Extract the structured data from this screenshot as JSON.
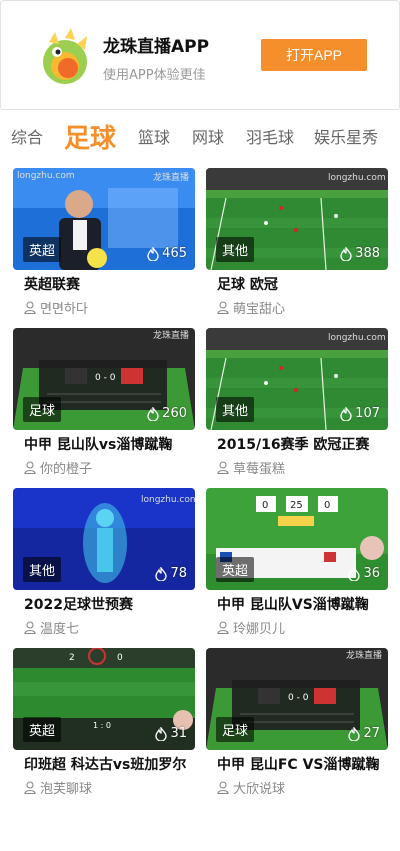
{
  "banner": {
    "title": "龙珠直播APP",
    "subtitle": "使用APP体验更佳",
    "open_button": "打开APP"
  },
  "tabs": [
    {
      "label": "综合",
      "active": false
    },
    {
      "label": "足球",
      "active": true
    },
    {
      "label": "篮球",
      "active": false
    },
    {
      "label": "网球",
      "active": false
    },
    {
      "label": "羽毛球",
      "active": false
    },
    {
      "label": "娱乐星秀",
      "active": false
    }
  ],
  "cards": [
    {
      "category": "英超",
      "views": "465",
      "title": "英超联赛",
      "user": "면면하다",
      "thumb": "studio"
    },
    {
      "category": "其他",
      "views": "388",
      "title": "足球 欧冠",
      "user": "萌宝甜心",
      "thumb": "pitch"
    },
    {
      "category": "足球",
      "views": "260",
      "title": "中甲 昆山队vs淄博蹴鞠",
      "user": "你的橙子",
      "thumb": "scoreboard"
    },
    {
      "category": "其他",
      "views": "107",
      "title": "2015/16赛季 欧冠正赛",
      "user": "草莓蛋糕",
      "thumb": "pitch"
    },
    {
      "category": "其他",
      "views": "78",
      "title": "2022足球世预赛",
      "user": "温度七",
      "thumb": "trophy"
    },
    {
      "category": "英超",
      "views": "36",
      "title": "中甲 昆山队VS淄博蹴鞠",
      "user": "玲娜贝儿",
      "thumb": "board"
    },
    {
      "category": "英超",
      "views": "31",
      "title": "印班超 科达古vs班加罗尔",
      "user": "泡芙聊球",
      "thumb": "aerial"
    },
    {
      "category": "足球",
      "views": "27",
      "title": "中甲 昆山FC VS淄博蹴鞠",
      "user": "大欣说球",
      "thumb": "scoreboard"
    }
  ]
}
